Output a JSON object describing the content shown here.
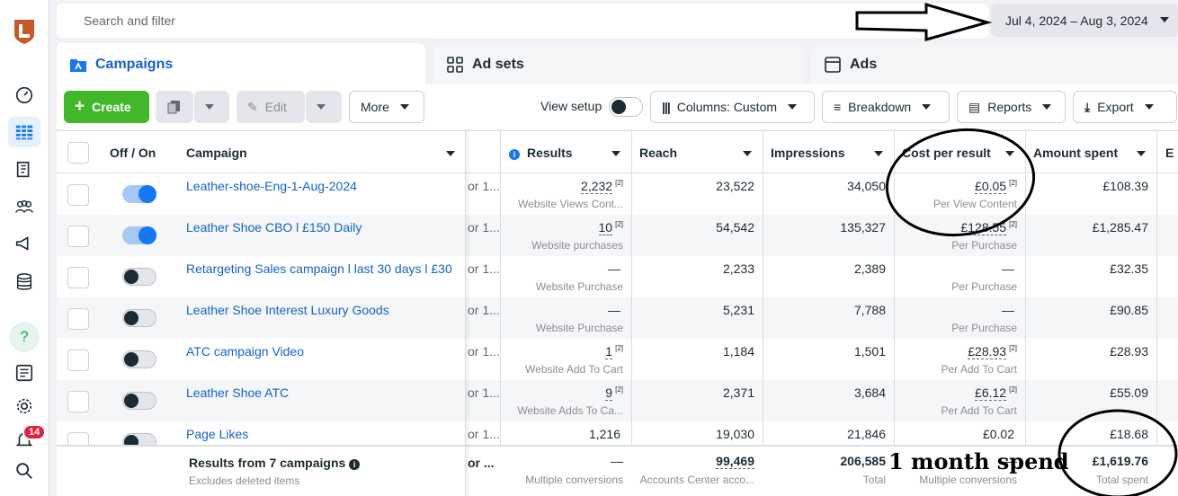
{
  "nav": {
    "icons": [
      "logo-icon",
      "dashboard-icon",
      "campaigns-grid-icon",
      "pages-icon",
      "audience-icon",
      "megaphone-icon",
      "database-icon",
      "help-icon",
      "report-icon",
      "settings-icon",
      "notifications-icon",
      "search-icon"
    ],
    "notification_count": "14",
    "help_symbol": "?"
  },
  "search": {
    "placeholder": "Search and filter"
  },
  "date_range": "Jul 4, 2024 – Aug 3, 2024",
  "tabs": [
    "Campaigns",
    "Ad sets",
    "Ads"
  ],
  "toolbar": {
    "create": "Create",
    "edit": "Edit",
    "more": "More",
    "view_setup": "View setup",
    "columns": "Columns: Custom",
    "breakdown": "Breakdown",
    "reports": "Reports",
    "export": "Export"
  },
  "columns": [
    "Off / On",
    "Campaign",
    "Results",
    "Reach",
    "Impressions",
    "Cost per result",
    "Amount spent",
    "E"
  ],
  "rows": [
    {
      "on": true,
      "name": "Leather-shoe-Eng-1-Aug-2024",
      "trunc": "or 1...",
      "results": "2,232",
      "results_fn": "[2]",
      "results_sub": "Website Views Cont...",
      "reach": "23,522",
      "impressions": "34,050",
      "cpr": "£0.05",
      "cpr_fn": "[2]",
      "cpr_sub": "Per View Content",
      "spent": "£108.39"
    },
    {
      "on": true,
      "name": "Leather Shoe CBO l £150 Daily",
      "trunc": "or 1...",
      "results": "10",
      "results_fn": "[2]",
      "results_sub": "Website purchases",
      "reach": "54,542",
      "impressions": "135,327",
      "cpr": "£128.55",
      "cpr_fn": "[2]",
      "cpr_sub": "Per Purchase",
      "spent": "£1,285.47"
    },
    {
      "on": false,
      "name": "Retargeting Sales campaign l last 30 days l £30",
      "trunc": "or 1...",
      "results": "—",
      "results_fn": "",
      "results_sub": "Website Purchase",
      "reach": "2,233",
      "impressions": "2,389",
      "cpr": "—",
      "cpr_fn": "",
      "cpr_sub": "Per Purchase",
      "spent": "£32.35"
    },
    {
      "on": false,
      "name": "Leather Shoe Interest Luxury Goods",
      "trunc": "or 1...",
      "results": "—",
      "results_fn": "",
      "results_sub": "Website Purchase",
      "reach": "5,231",
      "impressions": "7,788",
      "cpr": "—",
      "cpr_fn": "",
      "cpr_sub": "Per Purchase",
      "spent": "£90.85"
    },
    {
      "on": false,
      "name": "ATC campaign Video",
      "trunc": "or 1...",
      "results": "1",
      "results_fn": "[2]",
      "results_sub": "Website Add To Cart",
      "reach": "1,184",
      "impressions": "1,501",
      "cpr": "£28.93",
      "cpr_fn": "[2]",
      "cpr_sub": "Per Add To Cart",
      "spent": "£28.93"
    },
    {
      "on": false,
      "name": "Leather Shoe ATC",
      "trunc": "or 1...",
      "results": "9",
      "results_fn": "[2]",
      "results_sub": "Website Adds To Ca...",
      "reach": "2,371",
      "impressions": "3,684",
      "cpr": "£6.12",
      "cpr_fn": "[2]",
      "cpr_sub": "Per Add To Cart",
      "spent": "£55.09"
    },
    {
      "on": false,
      "name": "Page Likes",
      "trunc": "or 1...",
      "results": "1,216",
      "results_fn": "",
      "results_sub": "",
      "reach": "19,030",
      "impressions": "21,846",
      "cpr": "£0.02",
      "cpr_fn": "",
      "cpr_sub": "",
      "spent": "£18.68"
    }
  ],
  "totals": {
    "label": "Results from 7 campaigns",
    "note": "Excludes deleted items",
    "trunc": "or ...",
    "results": "—",
    "results_sub": "Multiple conversions",
    "reach": "99,469",
    "reach_sub": "Accounts Center acco...",
    "impressions": "206,585",
    "impressions_sub": "Total",
    "cpr": "—",
    "cpr_sub": "Multiple conversions",
    "spent": "£1,619.76",
    "spent_sub": "Total spent"
  },
  "annotation": "1 month spend",
  "colors": {
    "accent": "#1877f2",
    "link": "#1463c8",
    "create": "#42b72a",
    "ink": "#000000"
  }
}
